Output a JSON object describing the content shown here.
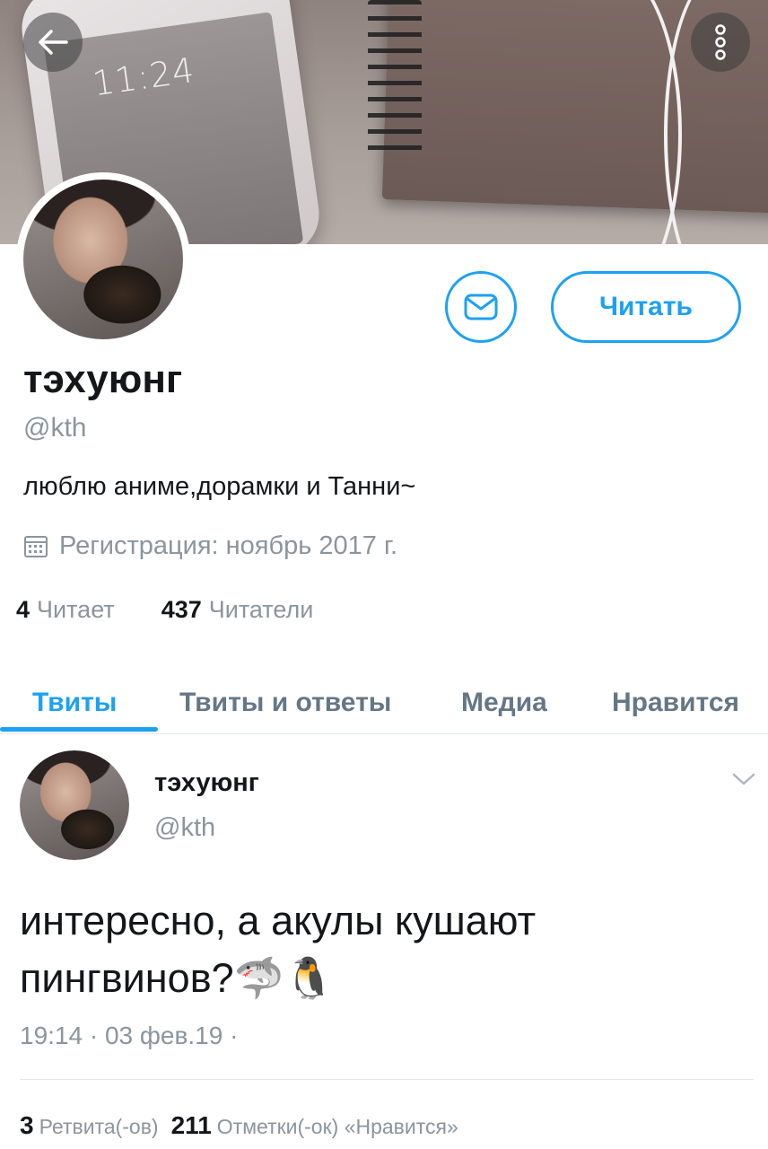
{
  "header": {
    "back_icon": "arrow-left-icon",
    "more_icon": "more-vertical-icon",
    "banner_clock": "11:24"
  },
  "profile": {
    "display_name": "тэхуюнг",
    "handle": "@kth",
    "bio": "люблю аниме,дорамки и Танни~",
    "joined": "Регистрация: ноябрь 2017 г.",
    "follow_label": "Читать",
    "following_count": "4",
    "following_label": "Читает",
    "followers_count": "437",
    "followers_label": "Читатели"
  },
  "tabs": [
    {
      "label": "Твиты",
      "active": true
    },
    {
      "label": "Твиты и ответы",
      "active": false
    },
    {
      "label": "Медиа",
      "active": false
    },
    {
      "label": "Нравится",
      "active": false
    }
  ],
  "tweet": {
    "name": "тэхуюнг",
    "handle": "@kth",
    "text": "интересно, а акулы кушают пингвинов?🦈🐧",
    "time": "19:14 · 03 фев.19 ·",
    "retweets_count": "3",
    "retweets_label": "Ретвита(-ов)",
    "likes_count": "211",
    "likes_label": "Отметки(-ок) «Нравится»"
  },
  "colors": {
    "accent": "#1da1f2",
    "secondary_text": "#8a959e",
    "primary_text": "#14171a"
  }
}
